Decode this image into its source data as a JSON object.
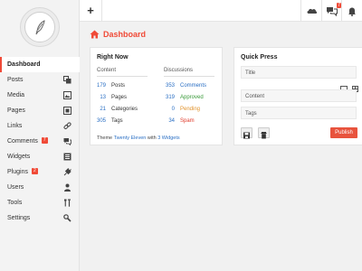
{
  "sidebar": {
    "items": [
      {
        "label": "Dashboard",
        "icon": "",
        "badge": ""
      },
      {
        "label": "Posts",
        "icon": "posts-icon",
        "badge": ""
      },
      {
        "label": "Media",
        "icon": "media-icon",
        "badge": ""
      },
      {
        "label": "Pages",
        "icon": "pages-icon",
        "badge": ""
      },
      {
        "label": "Links",
        "icon": "links-icon",
        "badge": ""
      },
      {
        "label": "Comments",
        "icon": "comments-icon",
        "badge": "7"
      },
      {
        "label": "Widgets",
        "icon": "widgets-icon",
        "badge": ""
      },
      {
        "label": "Plugins",
        "icon": "plugins-icon",
        "badge": "2"
      },
      {
        "label": "Users",
        "icon": "users-icon",
        "badge": ""
      },
      {
        "label": "Tools",
        "icon": "tools-icon",
        "badge": ""
      },
      {
        "label": "Settings",
        "icon": "settings-icon",
        "badge": ""
      }
    ]
  },
  "topbar": {
    "plus": "+",
    "notification_badge": "7"
  },
  "page": {
    "title": "Dashboard"
  },
  "right_now": {
    "title": "Right Now",
    "content_heading": "Content",
    "discussions_heading": "Discussions",
    "content": [
      {
        "num": "179",
        "label": "Posts"
      },
      {
        "num": "13",
        "label": "Pages"
      },
      {
        "num": "21",
        "label": "Categories"
      },
      {
        "num": "305",
        "label": "Tags"
      }
    ],
    "discussions": [
      {
        "num": "353",
        "label": "Comments",
        "color": "#2a6fc4"
      },
      {
        "num": "319",
        "label": "Approved",
        "color": "#3a9a3a"
      },
      {
        "num": "0",
        "label": "Pending",
        "color": "#e0922a"
      },
      {
        "num": "34",
        "label": "Spam",
        "color": "#e03a2a"
      }
    ],
    "theme_prefix": "Theme",
    "theme_name": "Twenty Eleven",
    "theme_with": "with",
    "theme_widgets": "3 Widgets"
  },
  "quick_press": {
    "title": "Quick Press",
    "title_placeholder": "Title",
    "content_placeholder": "Content",
    "tags_placeholder": "Tags",
    "publish_label": "Publish"
  },
  "colors": {
    "accent": "#f04a37",
    "link": "#2a6fc4"
  }
}
